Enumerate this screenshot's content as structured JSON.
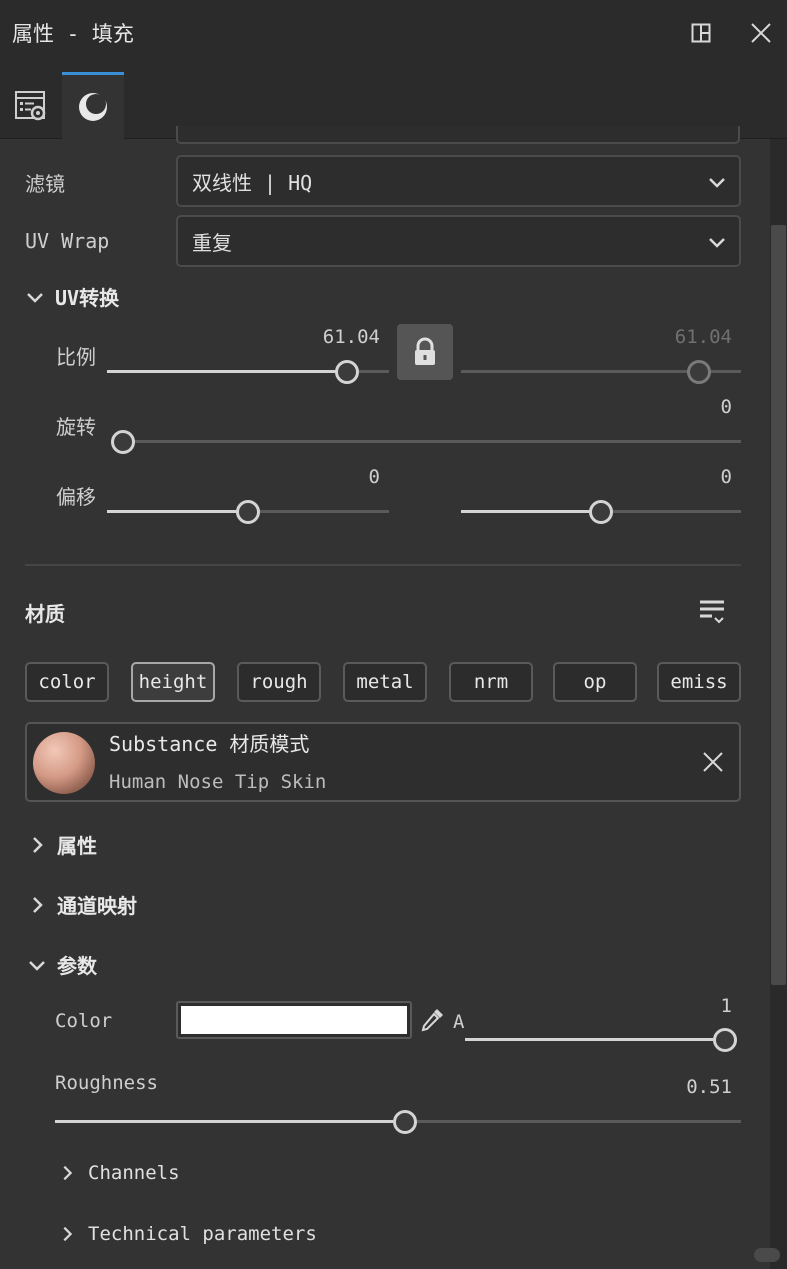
{
  "window": {
    "title": "属性 - 填充"
  },
  "filter": {
    "label": "滤镜",
    "value": "双线性 | HQ"
  },
  "uv_wrap": {
    "label": "UV Wrap",
    "value": "重复"
  },
  "uv_transform": {
    "title": "UV转换",
    "scale": {
      "label": "比例",
      "value_x": "61.04",
      "value_y": "61.04",
      "fraction_x": 0.85,
      "fraction_y": 0.85
    },
    "rotation": {
      "label": "旋转",
      "value": "0",
      "fraction": 0.0
    },
    "offset": {
      "label": "偏移",
      "value_x": "0",
      "value_y": "0",
      "fraction_x": 0.5,
      "fraction_y": 0.5
    }
  },
  "material": {
    "title": "材质",
    "channels": [
      "color",
      "height",
      "rough",
      "metal",
      "nrm",
      "op",
      "emiss"
    ],
    "selected_channel": "height",
    "card": {
      "title": "Substance 材质模式",
      "subtitle": "Human Nose Tip Skin"
    }
  },
  "sections": {
    "properties": "属性",
    "channel_mapping": "通道映射",
    "parameters": "参数"
  },
  "params": {
    "color": {
      "label": "Color",
      "swatch": "#ffffff",
      "alpha_label": "A",
      "alpha_value": "1",
      "alpha_fraction": 1.0
    },
    "roughness": {
      "label": "Roughness",
      "value": "0.51",
      "fraction": 0.51
    }
  },
  "subsections": {
    "channels": "Channels",
    "technical": "Technical parameters"
  },
  "colors": {
    "accent": "#3a8fd9",
    "background": "#333333"
  }
}
